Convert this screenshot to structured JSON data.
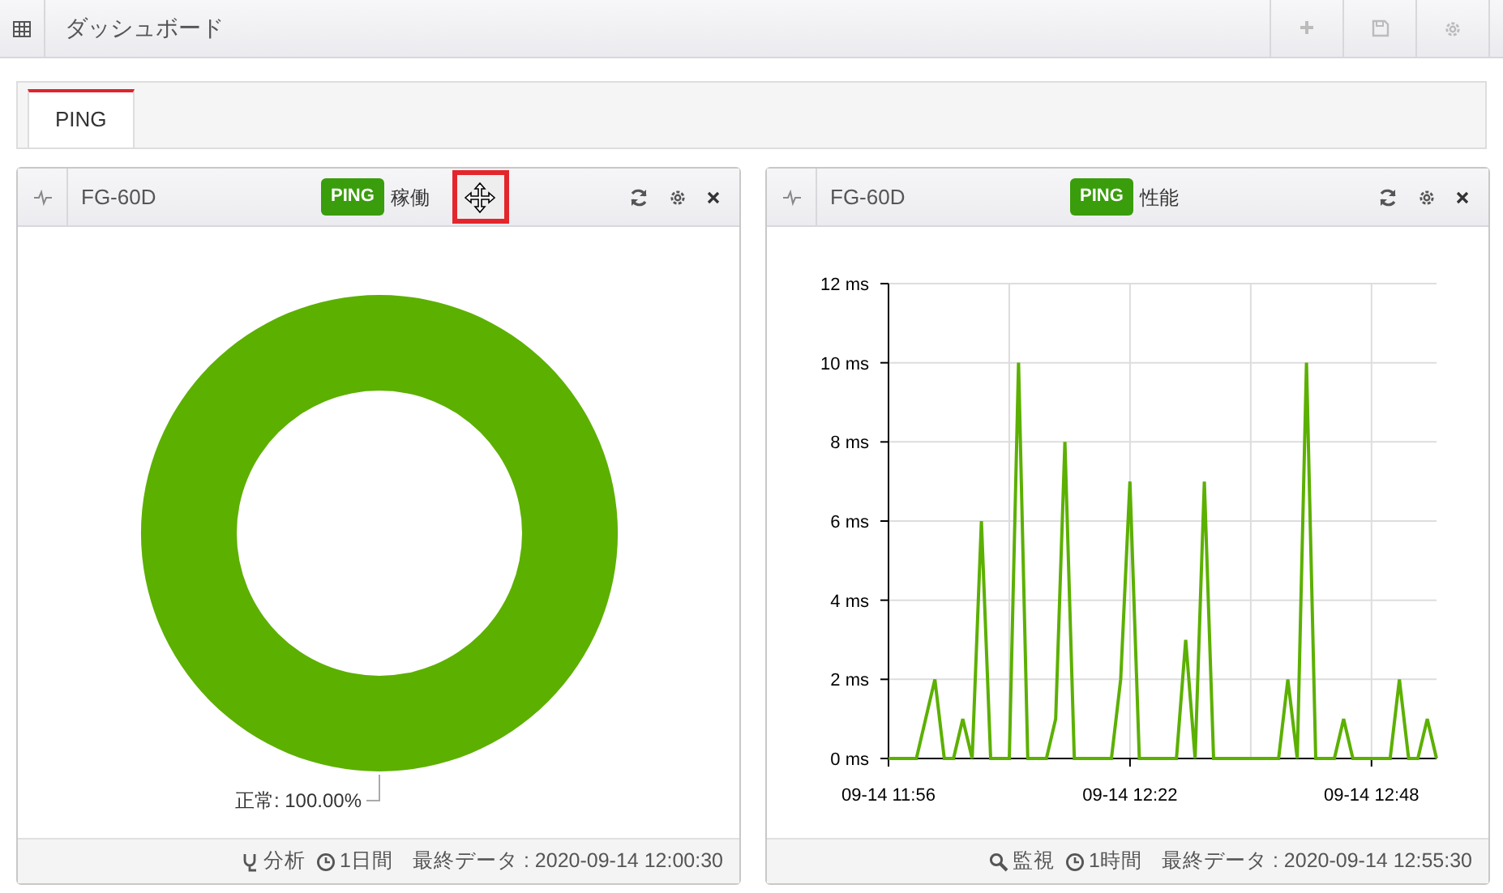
{
  "toolbar": {
    "title": "ダッシュボード"
  },
  "tabs": [
    {
      "label": "PING",
      "selected": true
    }
  ],
  "widgets": [
    {
      "device": "FG-60D",
      "badge": "PING",
      "title": "稼働",
      "move_handle": true,
      "chart_data": {
        "type": "pie",
        "series": [
          {
            "color": "#5cb000",
            "values": [
              100
            ]
          }
        ],
        "annotations": [
          {
            "text": "正常: 100.00%"
          }
        ]
      },
      "footer": {
        "action": {
          "kind": "analyze",
          "label": "分析"
        },
        "period": "1日間",
        "last_data": "最終データ : 2020-09-14 12:00:30"
      }
    },
    {
      "device": "FG-60D",
      "badge": "PING",
      "title": "性能",
      "chart_data": {
        "type": "line",
        "categories": [
          "09-14 11:56",
          null,
          null,
          null,
          null,
          null,
          null,
          null,
          null,
          null,
          null,
          null,
          null,
          null,
          null,
          null,
          null,
          null,
          null,
          null,
          null,
          null,
          null,
          null,
          null,
          null,
          "09-14 12:22",
          null,
          null,
          null,
          null,
          null,
          null,
          null,
          null,
          null,
          null,
          null,
          null,
          null,
          null,
          null,
          null,
          null,
          null,
          null,
          null,
          null,
          null,
          null,
          null,
          null,
          "09-14 12:48",
          null,
          null,
          null,
          null,
          null,
          null,
          null
        ],
        "series": [
          {
            "color": "#5cb000",
            "values": [
              0,
              0,
              0,
              0,
              1,
              2,
              0,
              0,
              1,
              0,
              6,
              0,
              0,
              0,
              10,
              0,
              0,
              0,
              1,
              8,
              0,
              0,
              0,
              0,
              0,
              2,
              7,
              0,
              0,
              0,
              0,
              0,
              3,
              0,
              7,
              0,
              0,
              0,
              0,
              0,
              0,
              0,
              0,
              2,
              0,
              10,
              0,
              0,
              0,
              1,
              0,
              0,
              0,
              0,
              0,
              2,
              0,
              0,
              1,
              0
            ]
          }
        ],
        "ylim": [
          0,
          12
        ],
        "grid": true,
        "yticks": [
          {
            "value": 0,
            "label": "0 ms"
          },
          {
            "value": 2,
            "label": "2 ms"
          },
          {
            "value": 4,
            "label": "4 ms"
          },
          {
            "value": 6,
            "label": "6 ms"
          },
          {
            "value": 8,
            "label": "8 ms"
          },
          {
            "value": 10,
            "label": "10 ms"
          },
          {
            "value": 12,
            "label": "12 ms"
          }
        ]
      },
      "footer": {
        "action": {
          "kind": "monitor",
          "label": "監視"
        },
        "period": "1時間",
        "last_data": "最終データ : 2020-09-14 12:55:30"
      }
    }
  ]
}
